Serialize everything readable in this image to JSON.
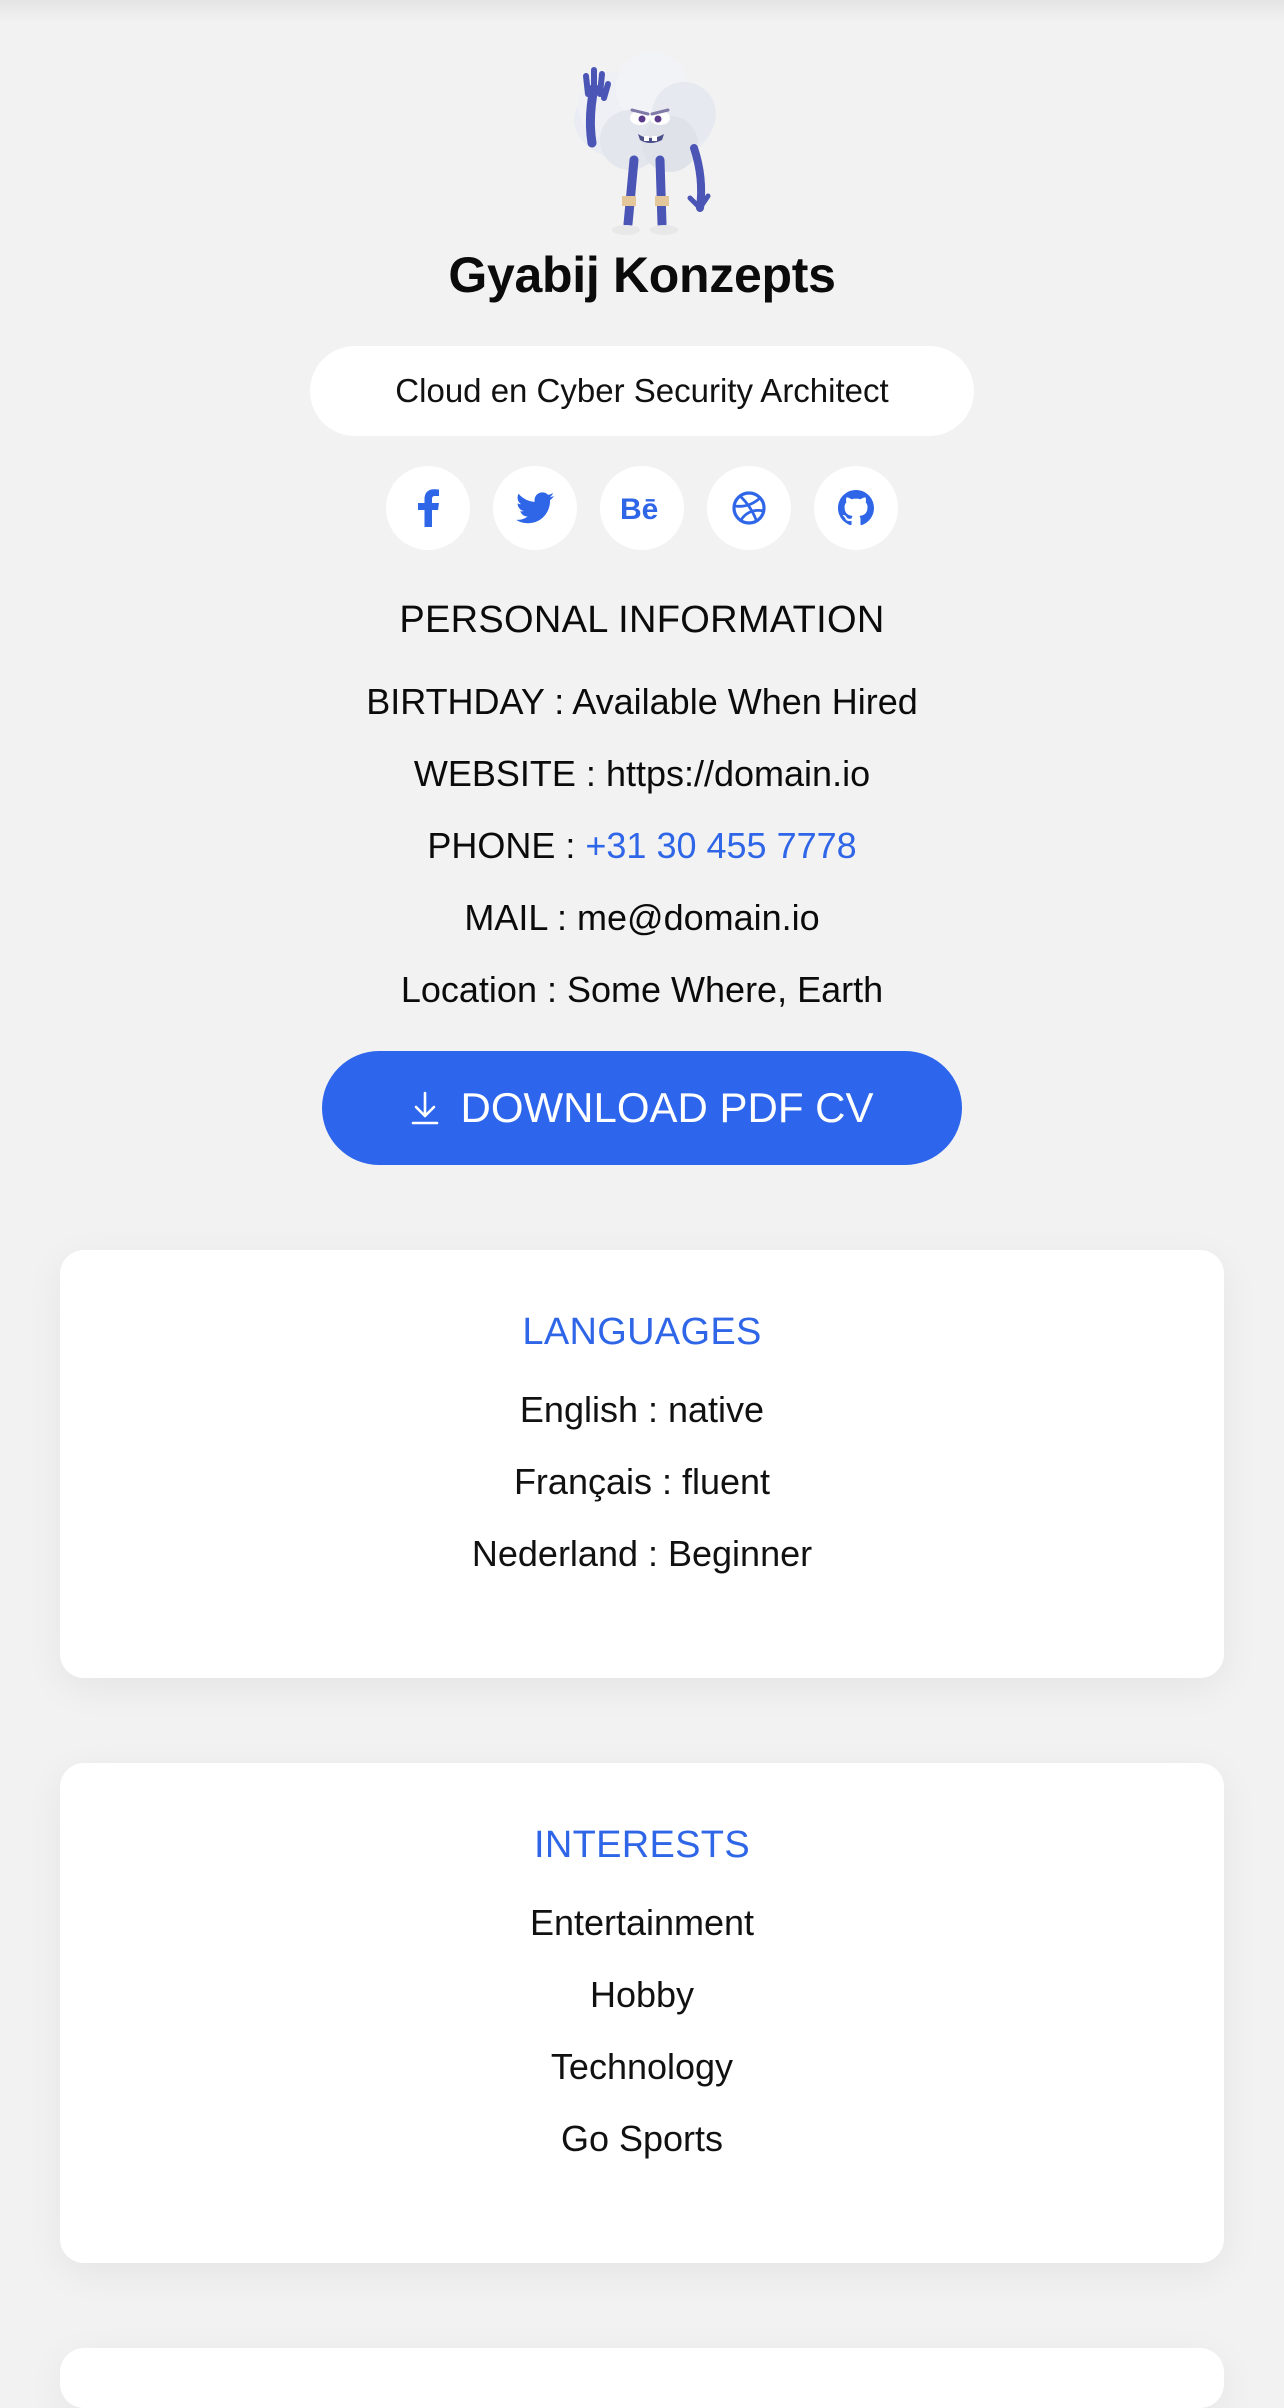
{
  "profile": {
    "name": "Gyabij Konzepts",
    "role": "Cloud en Cyber Security Architect",
    "avatar_icon": "cloud-character-avatar"
  },
  "socials": [
    {
      "icon": "facebook-icon",
      "glyph": "f"
    },
    {
      "icon": "twitter-icon",
      "glyph": "bird"
    },
    {
      "icon": "behance-icon",
      "glyph": "Bē"
    },
    {
      "icon": "dribbble-icon",
      "glyph": "ball"
    },
    {
      "icon": "github-icon",
      "glyph": "octocat"
    }
  ],
  "personal_info": {
    "title": "PERSONAL INFORMATION",
    "birthday_label": "BIRTHDAY :",
    "birthday_value": "Available When Hired",
    "website_label": "WEBSITE :",
    "website_value": "https://domain.io",
    "phone_label": "PHONE :",
    "phone_value": "+31 30 455 7778",
    "mail_label": "MAIL :",
    "mail_value": "me@domain.io",
    "location_label": "Location :",
    "location_value": "Some Where, Earth"
  },
  "download": {
    "label": "DOWNLOAD PDF CV",
    "icon": "download-arrow-icon"
  },
  "languages": {
    "title": "LANGUAGES",
    "items": [
      "English : native",
      "Français : fluent",
      "Nederland : Beginner"
    ]
  },
  "interests": {
    "title": "INTERESTS",
    "items": [
      "Entertainment",
      "Hobby",
      "Technology",
      "Go Sports"
    ]
  },
  "colors": {
    "accent": "#2f66e8",
    "button": "#2d66ec",
    "background": "#f2f2f2",
    "card": "#ffffff"
  }
}
